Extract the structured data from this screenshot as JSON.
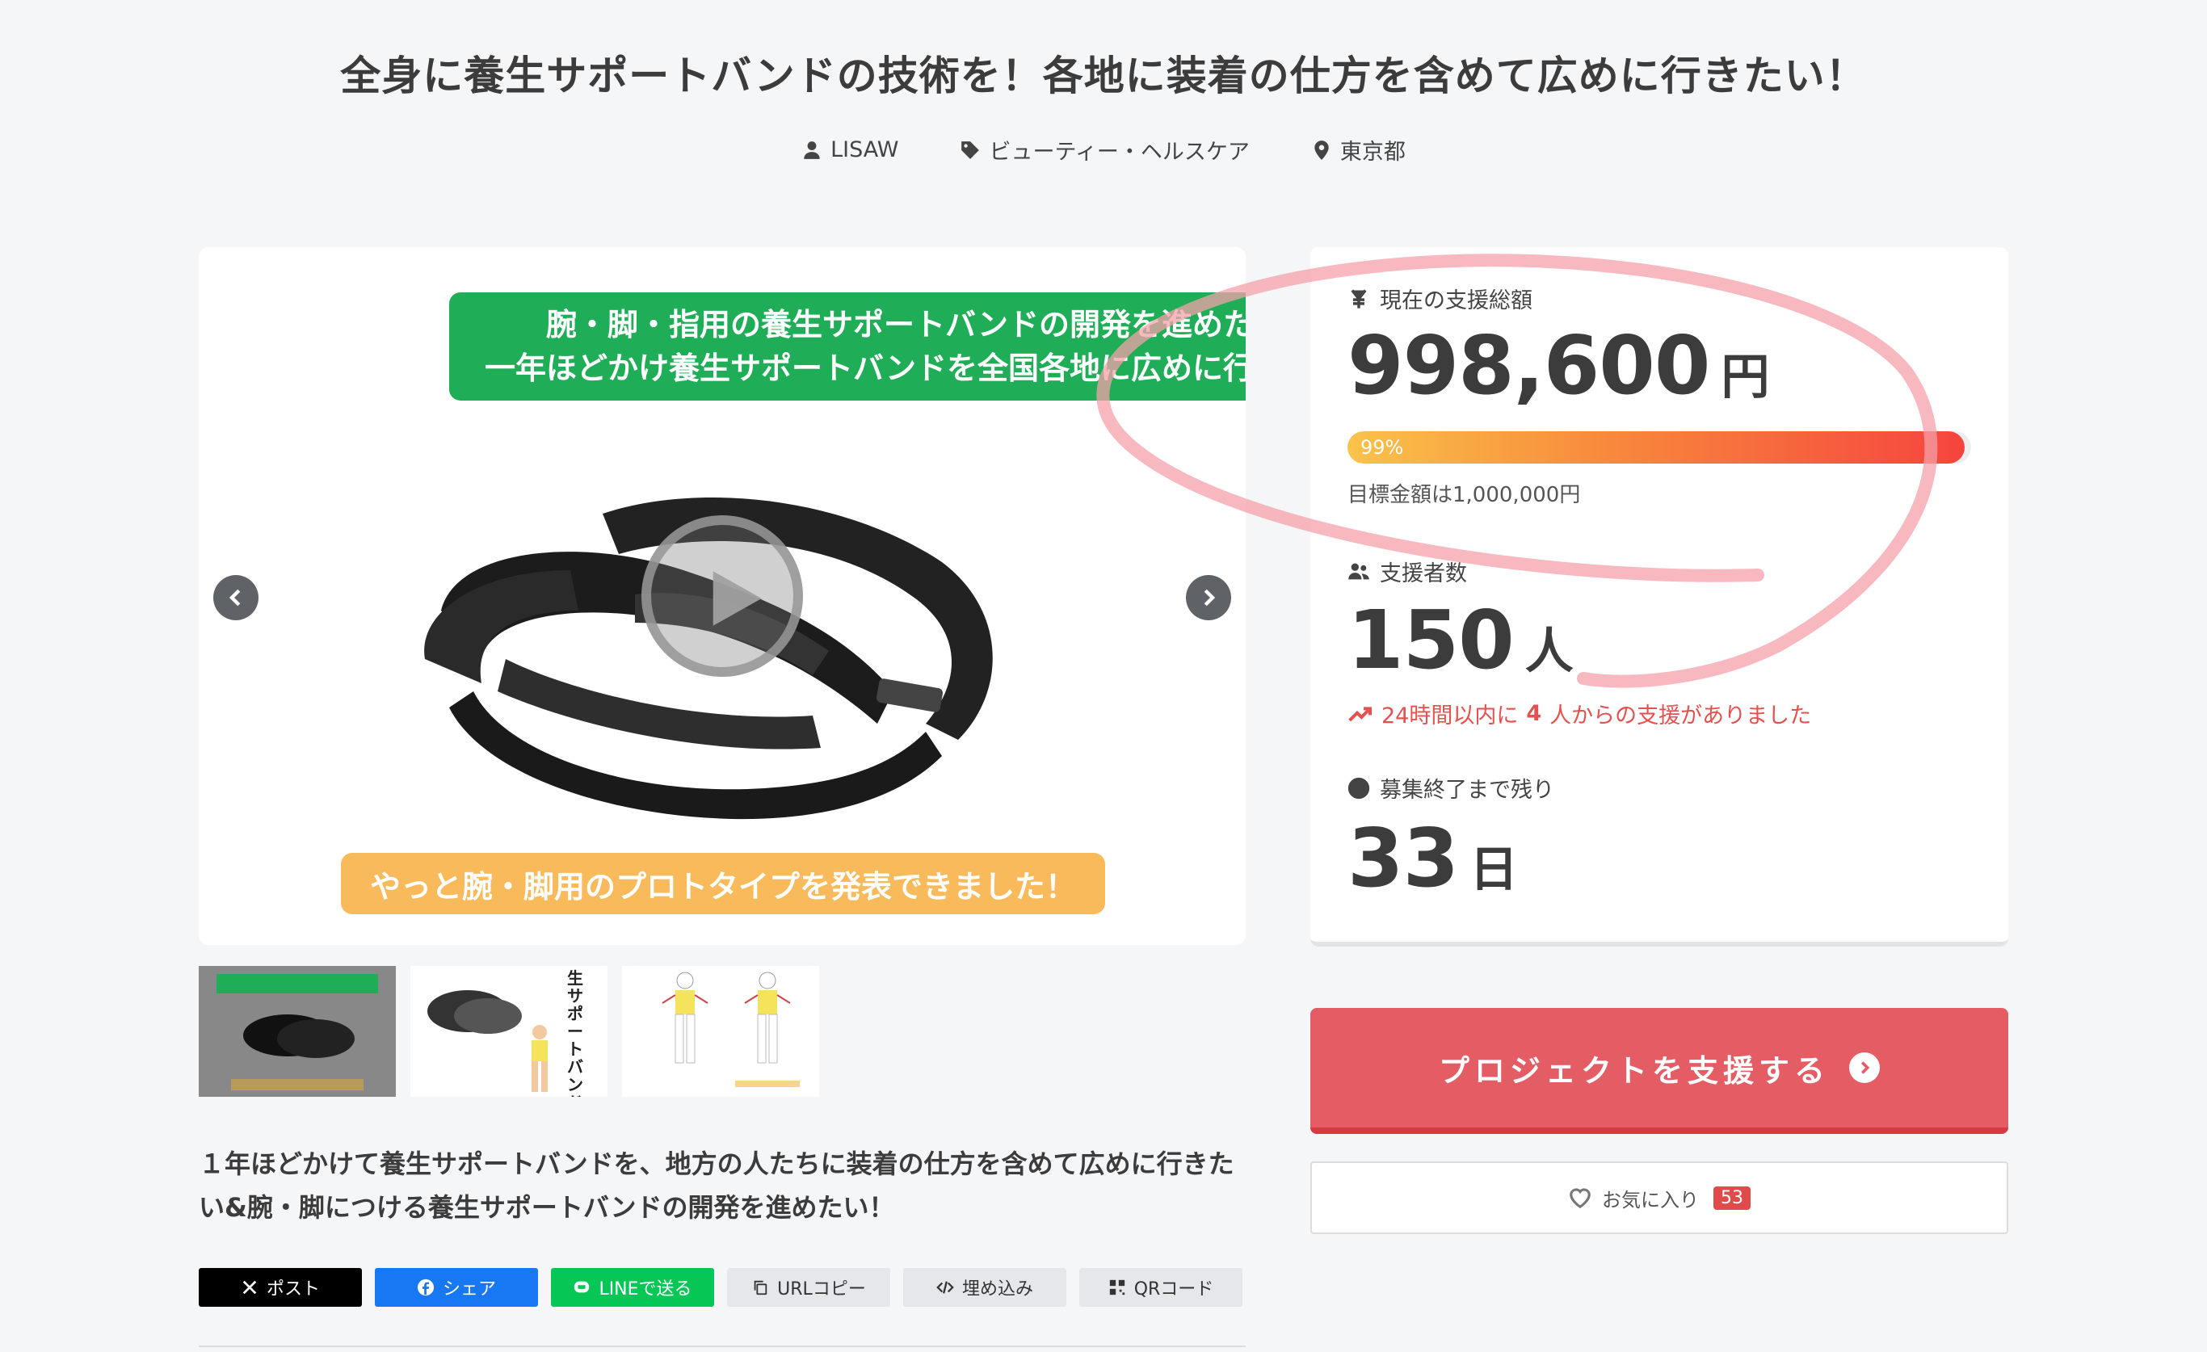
{
  "project": {
    "title": "全身に養生サポートバンドの技術を！各地に装着の仕方を含めて広めに行きたい！",
    "owner": "LISAW",
    "category": "ビューティー・ヘルスケア",
    "location": "東京都"
  },
  "media": {
    "banner_line1": "腕・脚・指用の養生サポートバンドの開発を進めたい！",
    "banner_line2": "一年ほどかけ養生サポートバンドを全国各地に広めに行きたい！",
    "banner_bottom": "やっと腕・脚用のプロトタイプを発表できました！",
    "thumbnails": [
      {
        "label": "thumbnail-1"
      },
      {
        "label": "thumbnail-2",
        "text": "生サポートバンド"
      },
      {
        "label": "thumbnail-3"
      }
    ]
  },
  "description": "１年ほどかけて養生サポートバンドを、地方の人たちに装着の仕方を含めて広めに行きたい&腕・脚につける養生サポートバンドの開発を進めたい！",
  "share": {
    "x": "ポスト",
    "facebook": "シェア",
    "line": "LINEで送る",
    "url_copy": "URLコピー",
    "embed": "埋め込み",
    "qr": "QRコード"
  },
  "stats": {
    "funding_label": "現在の支援総額",
    "funding_amount": "998,600",
    "funding_unit": "円",
    "progress_percent": 99,
    "progress_label": "99%",
    "goal_text": "目標金額は1,000,000円",
    "backers_label": "支援者数",
    "backers_count": "150",
    "backers_unit": "人",
    "recent_prefix": "24時間以内に",
    "recent_count": "4",
    "recent_suffix": "人からの支援がありました",
    "remaining_label": "募集終了まで残り",
    "remaining_days": "33",
    "remaining_unit": "日"
  },
  "actions": {
    "support_label": "プロジェクトを支援する",
    "favorite_label": "お気に入り",
    "favorite_count": "53"
  },
  "colors": {
    "support_button": "#e55d64",
    "green_banner": "#1fae57",
    "orange_banner": "#f8ba5a",
    "progress_start": "#f9c34a",
    "progress_end": "#f5443e",
    "annotation": "#f4a0aa"
  },
  "icons": {
    "owner": "user-icon",
    "category": "tag-icon",
    "location": "pin-icon",
    "funding": "yen-icon",
    "backers": "users-icon",
    "recent": "trend-up-icon",
    "remaining": "clock-icon"
  }
}
